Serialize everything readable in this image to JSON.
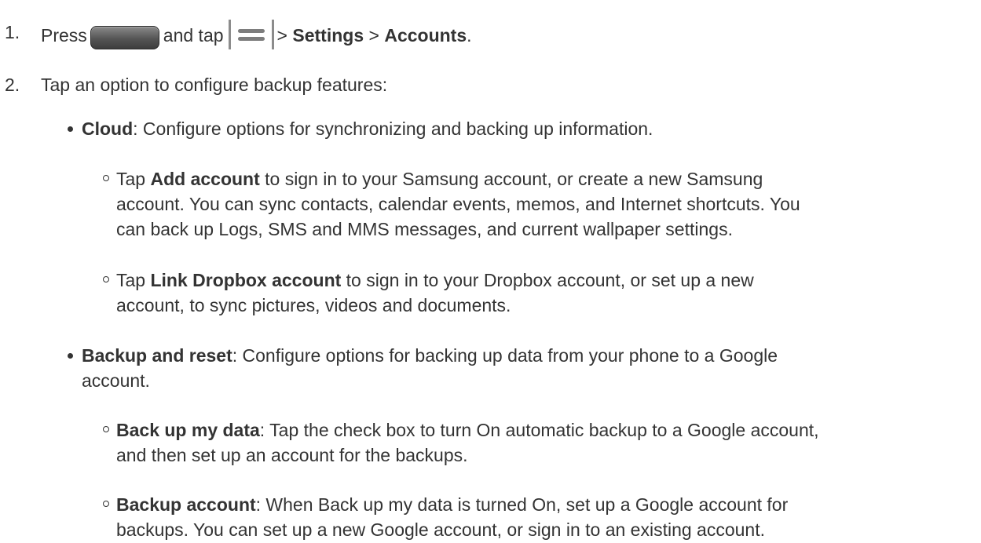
{
  "steps": [
    {
      "num": "1.",
      "press": "Press",
      "and_tap": "and tap",
      "sep1": ">",
      "settings": "Settings",
      "sep2": ">",
      "accounts": "Accounts",
      "period": ".",
      "home_key_icon": "home-key-icon",
      "menu_key_icon": "menu-key-icon"
    },
    {
      "num": "2.",
      "text": "Tap an option to configure backup features:"
    }
  ],
  "options": [
    {
      "bold": "Cloud",
      "text": ": Configure options for synchronizing and backing up information.",
      "subs": [
        {
          "prefix": "Tap ",
          "bold": "Add account",
          "lines": [
            " to sign in to your Samsung account, or create a new Samsung",
            "account. You can sync contacts, calendar events, memos, and Internet shortcuts. You",
            "can back up Logs, SMS and MMS messages, and current wallpaper settings."
          ]
        },
        {
          "prefix": "Tap ",
          "bold": "Link Dropbox account",
          "lines": [
            " to sign in to your Dropbox account, or set up a new",
            "account, to sync pictures, videos and documents."
          ]
        }
      ]
    },
    {
      "bold": "Backup and reset",
      "lines": [
        ": Configure options for backing up data from your phone to a Google",
        "account."
      ],
      "subs": [
        {
          "prefix": "",
          "bold": "Back up my data",
          "lines": [
            ": Tap the check box to turn On automatic backup to a Google account,",
            "and then set up an account for the backups."
          ]
        },
        {
          "prefix": "",
          "bold": "Backup account",
          "lines": [
            ": When Back up my data is turned On, set up a Google account for",
            "backups. You can set up a new Google account, or sign in to an existing account."
          ]
        }
      ]
    }
  ]
}
